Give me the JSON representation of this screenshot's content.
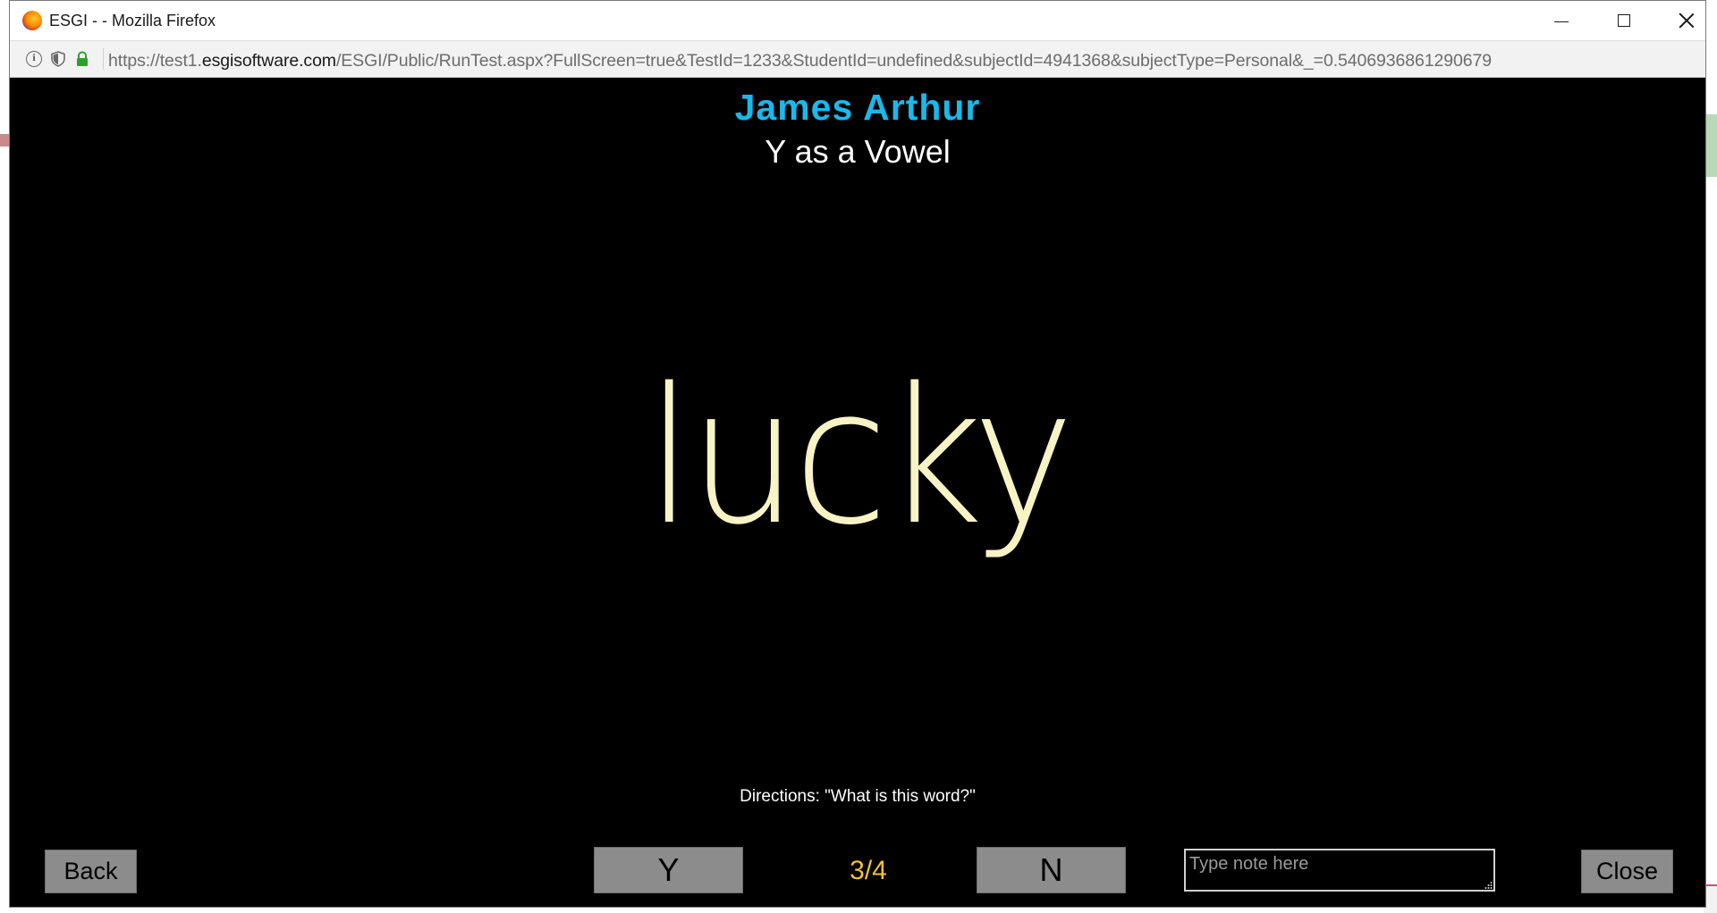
{
  "window": {
    "title": "ESGI - - Mozilla Firefox",
    "url_prefix": "https://test1.",
    "url_domain": "esgisoftware.com",
    "url_rest": "/ESGI/Public/RunTest.aspx?FullScreen=true&TestId=1233&StudentId=undefined&subjectId=4941368&subjectType=Personal&_=0.5406936861290679"
  },
  "header": {
    "student_name": "James Arthur",
    "test_name": "Y as a Vowel"
  },
  "question": {
    "word": "lucky",
    "directions": "Directions: \"What is this word?\""
  },
  "controls": {
    "back_label": "Back",
    "yes_label": "Y",
    "no_label": "N",
    "progress": "3/4",
    "note_placeholder": "Type note here",
    "close_label": "Close"
  },
  "colors": {
    "student_name": "#1bb8ea",
    "word": "#f7f3c4",
    "progress": "#f0c23b",
    "button_bg": "#8c8c8c",
    "background": "#000000"
  },
  "icons": [
    "firefox-icon",
    "info-icon",
    "tracking-shield-icon",
    "lock-icon",
    "minimize-icon",
    "maximize-icon",
    "close-icon",
    "resize-grip-icon"
  ]
}
